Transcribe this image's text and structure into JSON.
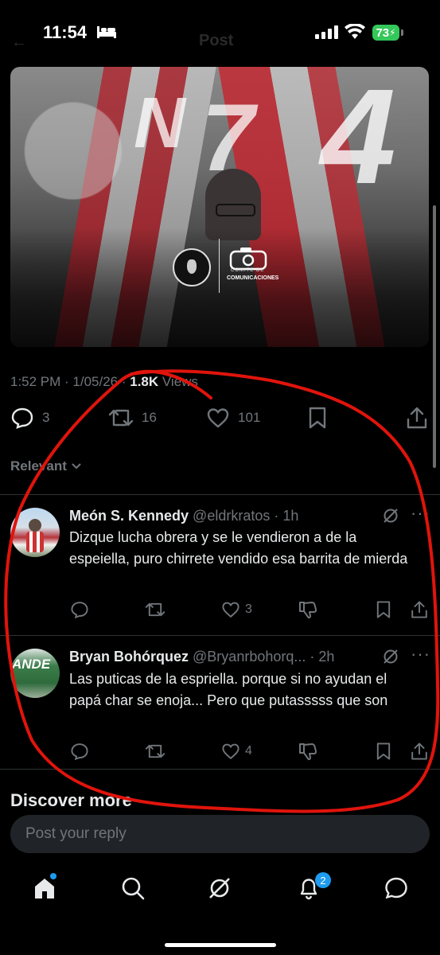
{
  "status_bar": {
    "time": "11:54",
    "battery": "73"
  },
  "header": {
    "title_faded": "Post"
  },
  "post": {
    "media_logo_caption_small": "COMITE DE",
    "media_logo_caption": "COMUNICACIONES",
    "jersey_numbers": [
      "N",
      "7",
      "4"
    ],
    "meta_time": "1:52 PM · 1/05/26 · ",
    "views_count": "1.8K",
    "views_label": " Views",
    "replies": "3",
    "reposts": "16",
    "likes": "101"
  },
  "sort": {
    "label": "Relevant"
  },
  "replies": [
    {
      "name": "Meón S. Kennedy",
      "handle": "@eldrkratos",
      "time": "· 1h",
      "text": "Dizque lucha obrera y se le vendieron a de la espeiella, puro chirrete vendido esa barrita de mierda",
      "likes": "3"
    },
    {
      "name": "Bryan Bohórquez",
      "handle": "@Bryanrbohorq...",
      "time": "· 2h",
      "avatar_text": "ANDE",
      "text": "Las puticas de la espriella. porque si no ayudan el papá char se enoja... Pero que putasssss que son",
      "likes": "4"
    }
  ],
  "discover": {
    "label": "Discover more"
  },
  "reply_box": {
    "placeholder": "Post your reply"
  },
  "tabbar": {
    "notifications_badge": "2"
  },
  "colors": {
    "accent": "#1d9bf0",
    "annotation": "#e0140c",
    "battery": "#34c759"
  }
}
